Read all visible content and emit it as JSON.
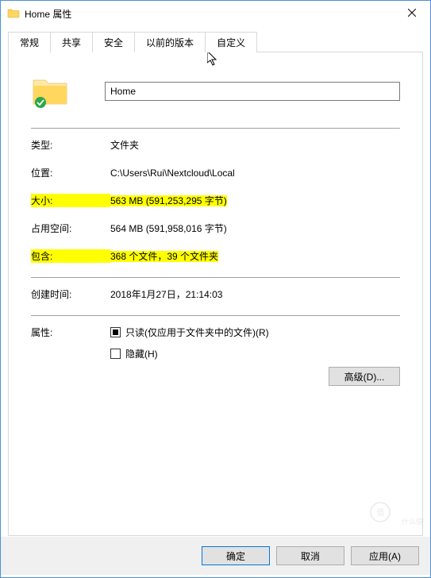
{
  "window": {
    "title": "Home 属性"
  },
  "tabs": {
    "general": "常规",
    "sharing": "共享",
    "security": "安全",
    "previous": "以前的版本",
    "custom": "自定义"
  },
  "folder": {
    "name": "Home"
  },
  "props": {
    "type_label": "类型:",
    "type_value": "文件夹",
    "location_label": "位置:",
    "location_value": "C:\\Users\\Rui\\Nextcloud\\Local",
    "size_label": "大小:",
    "size_value": "563 MB (591,253,295 字节)",
    "disk_label": "占用空间:",
    "disk_value": "564 MB (591,958,016 字节)",
    "contains_label": "包含:",
    "contains_value": "368 个文件，39 个文件夹",
    "created_label": "创建时间:",
    "created_value": "2018年1月27日，21:14:03"
  },
  "attributes": {
    "label": "属性:",
    "readonly": "只读(仅应用于文件夹中的文件)(R)",
    "hidden": "隐藏(H)",
    "advanced": "高级(D)..."
  },
  "buttons": {
    "ok": "确定",
    "cancel": "取消",
    "apply": "应用(A)"
  },
  "watermark": "什么值得买"
}
